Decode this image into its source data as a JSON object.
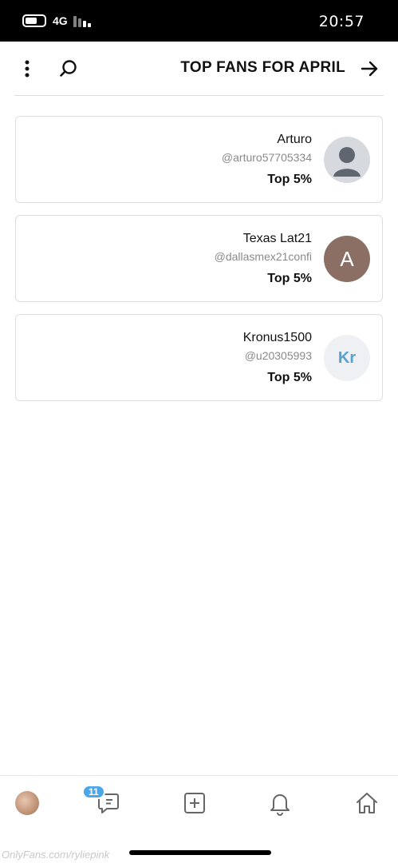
{
  "status_bar": {
    "time": "20:57",
    "network": "4G"
  },
  "header": {
    "title": "TOP FANS FOR APRIL"
  },
  "fans": [
    {
      "name": "Arturo",
      "handle": "@arturo57705334",
      "rank": "Top 5%",
      "avatar_text": ""
    },
    {
      "name": "Texas Lat21",
      "handle": "@dallasmex21confi",
      "rank": "Top 5%",
      "avatar_text": "A"
    },
    {
      "name": "Kronus1500",
      "handle": "@u20305993",
      "rank": "Top 5%",
      "avatar_text": "Kr"
    }
  ],
  "bottom_nav": {
    "messages_badge": "11",
    "icons": [
      "profile-avatar",
      "messages-icon",
      "add-post-icon",
      "notifications-icon",
      "home-icon"
    ]
  },
  "watermark": "OnlyFans.com/ryliepink",
  "colors": {
    "accent": "#4aa7e8",
    "letter_avatar": "#8b6f64",
    "initials_text": "#5aa0cf"
  }
}
